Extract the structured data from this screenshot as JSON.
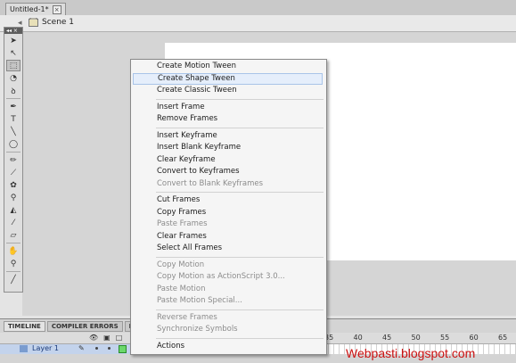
{
  "document_tab": {
    "title": "Untitled-1*",
    "close_icon": "close-icon"
  },
  "scene": {
    "label": "Scene 1"
  },
  "toolbar": {
    "tools": [
      "selection-tool-icon",
      "subselection-tool-icon",
      "free-transform-tool-icon",
      "gradient-transform-tool-icon",
      "lasso-tool-icon",
      "pen-tool-icon",
      "text-tool-icon",
      "line-tool-icon",
      "oval-tool-icon",
      "pencil-tool-icon",
      "brush-tool-icon",
      "deco-tool-icon",
      "bone-tool-icon",
      "paint-bucket-tool-icon",
      "eyedropper-tool-icon",
      "eraser-tool-icon",
      "hand-tool-icon",
      "zoom-tool-icon",
      "stroke-color-icon"
    ]
  },
  "timeline": {
    "tabs": [
      "TIMELINE",
      "COMPILER ERRORS",
      "M"
    ],
    "ruler": [
      "35",
      "40",
      "45",
      "50",
      "55",
      "60",
      "65"
    ],
    "layer_name": "Layer 1"
  },
  "context_menu": {
    "groups": [
      [
        {
          "label": "Create Motion Tween",
          "enabled": true
        },
        {
          "label": "Create Shape Tween",
          "enabled": true,
          "hover": true
        },
        {
          "label": "Create Classic Tween",
          "enabled": true
        }
      ],
      [
        {
          "label": "Insert Frame",
          "enabled": true
        },
        {
          "label": "Remove Frames",
          "enabled": true
        }
      ],
      [
        {
          "label": "Insert Keyframe",
          "enabled": true
        },
        {
          "label": "Insert Blank Keyframe",
          "enabled": true
        },
        {
          "label": "Clear Keyframe",
          "enabled": true
        },
        {
          "label": "Convert to Keyframes",
          "enabled": true
        },
        {
          "label": "Convert to Blank Keyframes",
          "enabled": false
        }
      ],
      [
        {
          "label": "Cut Frames",
          "enabled": true
        },
        {
          "label": "Copy Frames",
          "enabled": true
        },
        {
          "label": "Paste Frames",
          "enabled": false
        },
        {
          "label": "Clear Frames",
          "enabled": true
        },
        {
          "label": "Select All Frames",
          "enabled": true
        }
      ],
      [
        {
          "label": "Copy Motion",
          "enabled": false
        },
        {
          "label": "Copy Motion as ActionScript 3.0...",
          "enabled": false
        },
        {
          "label": "Paste Motion",
          "enabled": false
        },
        {
          "label": "Paste Motion Special...",
          "enabled": false
        }
      ],
      [
        {
          "label": "Reverse Frames",
          "enabled": false
        },
        {
          "label": "Synchronize Symbols",
          "enabled": false
        }
      ],
      [
        {
          "label": "Actions",
          "enabled": true
        }
      ]
    ]
  },
  "watermark": "Webpasti.blogspot.com",
  "colors": {
    "hover_bg": "#e5eefb",
    "disabled_text": "#8c8c8c",
    "watermark": "#cc1111"
  }
}
